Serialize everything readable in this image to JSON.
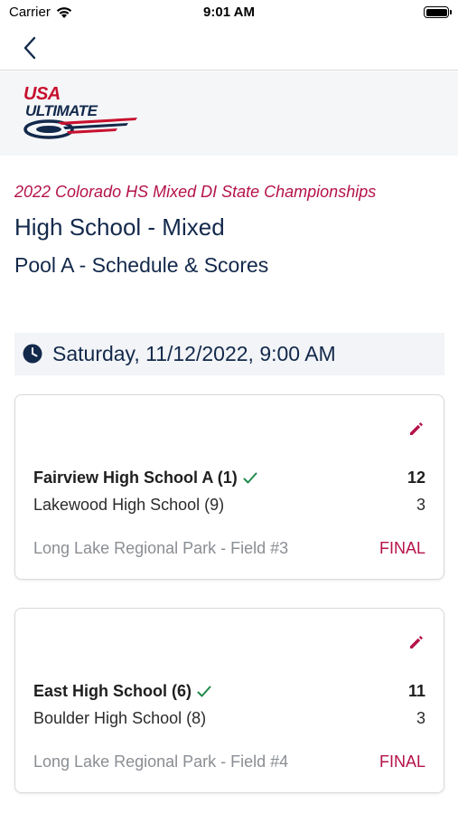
{
  "status_bar": {
    "carrier": "Carrier",
    "time": "9:01 AM"
  },
  "nav": {
    "back_icon": "chevron-left-icon"
  },
  "logo": {
    "line1": "USA",
    "line2": "ULTIMATE"
  },
  "header": {
    "event_name": "2022 Colorado HS Mixed DI State Championships",
    "division": "High School - Mixed",
    "pool": "Pool A - Schedule & Scores"
  },
  "schedule": {
    "date_label": "Saturday, 11/12/2022, 9:00 AM",
    "games": [
      {
        "team1": {
          "name": "Fairview High School A (1)",
          "score": "12",
          "winner": true
        },
        "team2": {
          "name": "Lakewood High School (9)",
          "score": "3",
          "winner": false
        },
        "location": "Long Lake Regional Park - Field #3",
        "status": "FINAL"
      },
      {
        "team1": {
          "name": "East High School (6)",
          "score": "11",
          "winner": true
        },
        "team2": {
          "name": "Boulder High School (8)",
          "score": "3",
          "winner": false
        },
        "location": "Long Lake Regional Park - Field #4",
        "status": "FINAL"
      }
    ]
  },
  "colors": {
    "navy": "#13294b",
    "accent": "#b5124b",
    "win_check": "#1f8a4c",
    "muted": "#8a8e93"
  }
}
